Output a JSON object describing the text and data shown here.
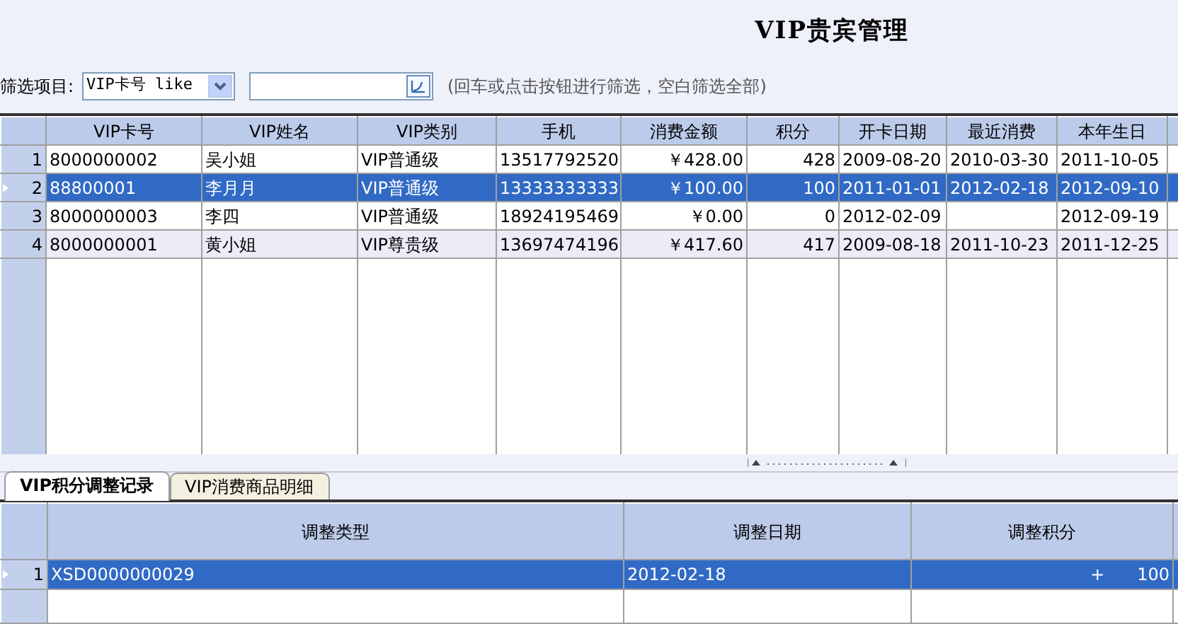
{
  "title": "VIP贵宾管理",
  "filter": {
    "label": "筛选项目:",
    "field": "VIP卡号 like",
    "hint": "(回车或点击按钮进行筛选，空白筛选全部)"
  },
  "members_table": {
    "columns": [
      "VIP卡号",
      "VIP姓名",
      "VIP类别",
      "手机",
      "消费金额",
      "积分",
      "开卡日期",
      "最近消费",
      "本年生日"
    ],
    "rows": [
      {
        "number": "1",
        "selected": false,
        "cells": [
          "8000000002",
          "吴小姐",
          "VIP普通级",
          "13517792520",
          "￥428.00",
          "428",
          "2009-08-20",
          "2010-03-30",
          "2011-10-05"
        ]
      },
      {
        "number": "2",
        "selected": true,
        "cells": [
          "88800001",
          "李月月",
          "VIP普通级",
          "13333333333",
          "￥100.00",
          "100",
          "2011-01-01",
          "2012-02-18",
          "2012-09-10"
        ]
      },
      {
        "number": "3",
        "selected": false,
        "cells": [
          "8000000003",
          "李四",
          "VIP普通级",
          "18924195469",
          "￥0.00",
          "0",
          "2012-02-09",
          "",
          "2012-09-19"
        ]
      },
      {
        "number": "4",
        "selected": false,
        "cells": [
          "8000000001",
          "黄小姐",
          "VIP尊贵级",
          "13697474196",
          "￥417.60",
          "417",
          "2009-08-18",
          "2011-10-23",
          "2011-12-25"
        ]
      }
    ]
  },
  "tabs": [
    {
      "label": "VIP积分调整记录",
      "selected": true
    },
    {
      "label": "VIP消费商品明细",
      "selected": false
    }
  ],
  "adjustments_table": {
    "columns": [
      "调整类型",
      "调整日期",
      "调整积分"
    ],
    "rows": [
      {
        "number": "1",
        "selected": true,
        "cells": [
          "XSD0000000029",
          "2012-02-18",
          "+      100"
        ]
      }
    ]
  }
}
